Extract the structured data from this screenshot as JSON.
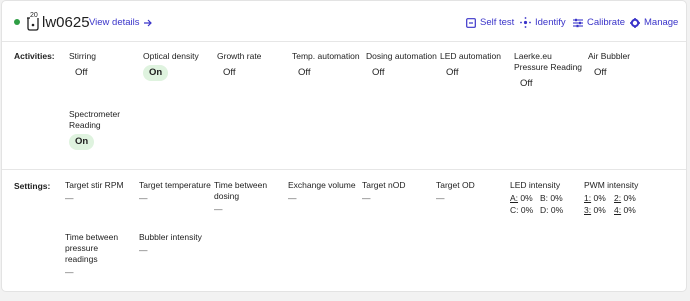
{
  "header": {
    "unit_number": "20",
    "unit_name": "lw0625",
    "view_details": "View details",
    "actions": [
      "Self test",
      "Identify",
      "Calibrate",
      "Manage"
    ]
  },
  "activities": {
    "label": "Activities:",
    "items": [
      {
        "name": "Stirring",
        "state": "Off"
      },
      {
        "name": "Optical density",
        "state": "On"
      },
      {
        "name": "Growth rate",
        "state": "Off"
      },
      {
        "name": "Temp. automation",
        "state": "Off"
      },
      {
        "name": "Dosing automation",
        "state": "Off"
      },
      {
        "name": "LED automation",
        "state": "Off"
      },
      {
        "name": "Laerke.eu Pressure Reading",
        "state": "Off"
      },
      {
        "name": "Air Bubbler",
        "state": "Off"
      },
      {
        "name": "Spectrometer Reading",
        "state": "On"
      }
    ]
  },
  "settings": {
    "label": "Settings:",
    "items": [
      {
        "name": "Target stir RPM",
        "value": "—"
      },
      {
        "name": "Target temperature",
        "value": "—"
      },
      {
        "name": "Time between dosing",
        "value": "—"
      },
      {
        "name": "Exchange volume",
        "value": "—"
      },
      {
        "name": "Target nOD",
        "value": "—"
      },
      {
        "name": "Target OD",
        "value": "—"
      },
      {
        "name": "Time between pressure readings",
        "value": "—"
      },
      {
        "name": "Bubbler intensity",
        "value": "—"
      }
    ],
    "led_intensity": {
      "name": "LED intensity",
      "channels": [
        {
          "label": "A:",
          "value": "0%"
        },
        {
          "label": "B:",
          "value": "0%"
        },
        {
          "label": "C:",
          "value": "0%"
        },
        {
          "label": "D:",
          "value": "0%"
        }
      ]
    },
    "pwm_intensity": {
      "name": "PWM intensity",
      "channels": [
        {
          "label": "1:",
          "value": "0%"
        },
        {
          "label": "2:",
          "value": "0%"
        },
        {
          "label": "3:",
          "value": "0%"
        },
        {
          "label": "4:",
          "value": "0%"
        }
      ]
    }
  },
  "colors": {
    "accent": "#3a34c9",
    "status_dot": "#2e9e44",
    "chip_on_bg": "#dff3df"
  }
}
